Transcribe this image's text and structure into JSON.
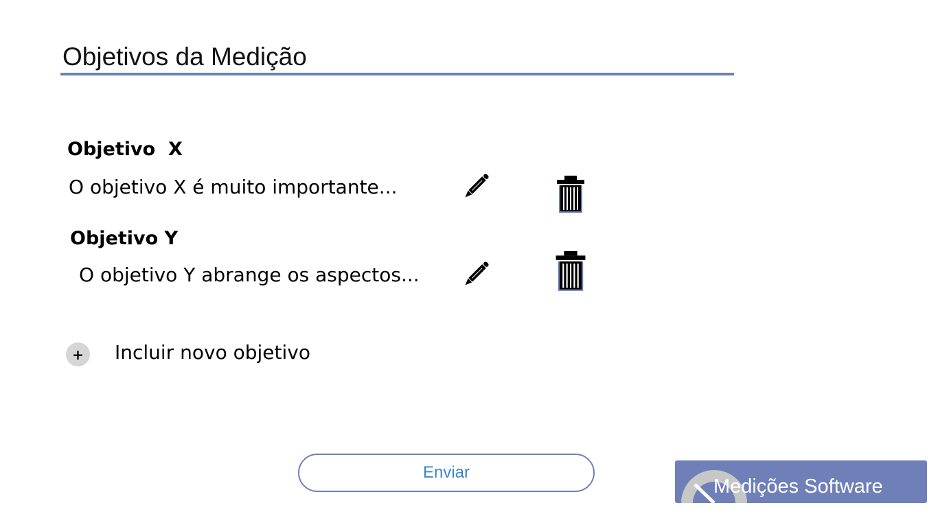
{
  "header": {
    "title": "Objetivos da Medição"
  },
  "objectives": [
    {
      "name": "Objetivo  X",
      "description": "O objetivo X é muito importante..."
    },
    {
      "name": "Objetivo Y",
      "description": "O objetivo Y abrange os aspectos..."
    }
  ],
  "icons": {
    "edit": "pencil-icon",
    "delete": "trash-icon",
    "add": "plus-icon"
  },
  "add_objective": {
    "symbol": "+",
    "label": "Incluir novo objetivo"
  },
  "submit": {
    "label": "Enviar"
  },
  "brand": {
    "name": "Medições Software"
  },
  "colors": {
    "accent": "#6f80b8",
    "submit_text": "#3a86c8",
    "add_button_bg": "#d6d6d6"
  }
}
